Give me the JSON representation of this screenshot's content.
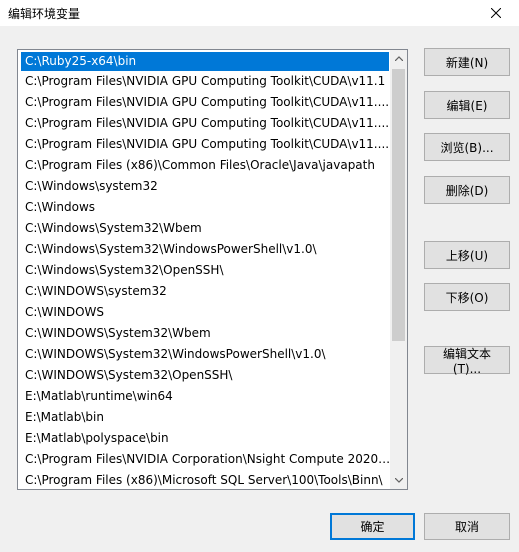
{
  "window": {
    "title": "编辑环境变量"
  },
  "list": {
    "items": [
      "C:\\Ruby25-x64\\bin",
      "C:\\Program Files\\NVIDIA GPU Computing Toolkit\\CUDA\\v11.1",
      "C:\\Program Files\\NVIDIA GPU Computing Toolkit\\CUDA\\v11....",
      "C:\\Program Files\\NVIDIA GPU Computing Toolkit\\CUDA\\v11....",
      "C:\\Program Files\\NVIDIA GPU Computing Toolkit\\CUDA\\v11....",
      "C:\\Program Files (x86)\\Common Files\\Oracle\\Java\\javapath",
      "C:\\Windows\\system32",
      "C:\\Windows",
      "C:\\Windows\\System32\\Wbem",
      "C:\\Windows\\System32\\WindowsPowerShell\\v1.0\\",
      "C:\\Windows\\System32\\OpenSSH\\",
      "C:\\WINDOWS\\system32",
      "C:\\WINDOWS",
      "C:\\WINDOWS\\System32\\Wbem",
      "C:\\WINDOWS\\System32\\WindowsPowerShell\\v1.0\\",
      "C:\\WINDOWS\\System32\\OpenSSH\\",
      "E:\\Matlab\\runtime\\win64",
      "E:\\Matlab\\bin",
      "E:\\Matlab\\polyspace\\bin",
      "C:\\Program Files\\NVIDIA Corporation\\Nsight Compute 2020....",
      "C:\\Program Files (x86)\\Microsoft SQL Server\\100\\Tools\\Binn\\"
    ],
    "selected_index": 0
  },
  "buttons": {
    "new": "新建(N)",
    "edit": "编辑(E)",
    "browse": "浏览(B)...",
    "delete": "删除(D)",
    "move_up": "上移(U)",
    "move_down": "下移(O)",
    "edit_text": "编辑文本(T)...",
    "ok": "确定",
    "cancel": "取消"
  },
  "icons": {
    "close": "close-icon",
    "scroll_up": "chevron-up-icon",
    "scroll_down": "chevron-down-icon"
  },
  "colors": {
    "selection": "#0078d7",
    "default_button_border": "#0078d7"
  }
}
